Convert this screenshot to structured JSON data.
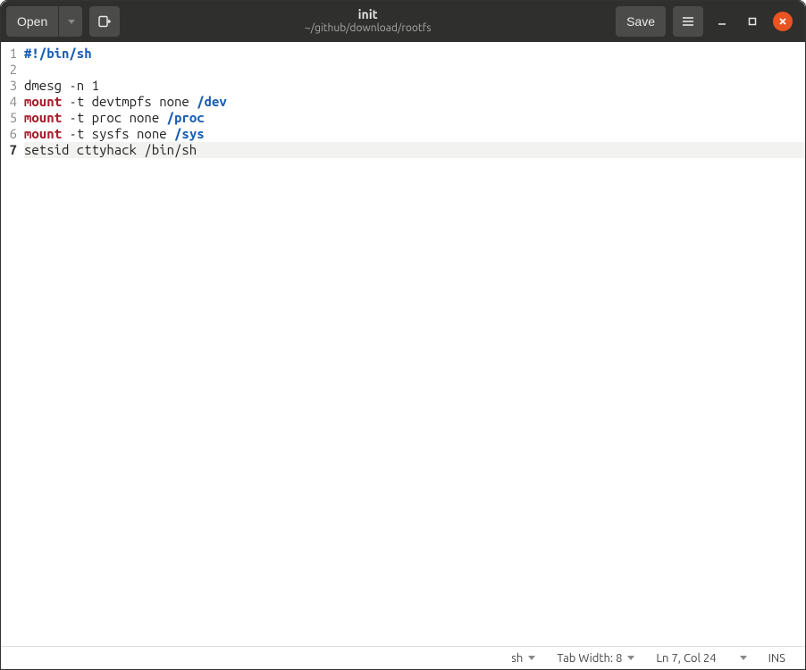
{
  "titlebar": {
    "open_label": "Open",
    "save_label": "Save",
    "title": "init",
    "subtitle": "~/github/download/rootfs"
  },
  "statusbar": {
    "language": "sh",
    "tab_width_label": "Tab Width: 8",
    "cursor_pos": "Ln 7, Col 24",
    "mode": "INS"
  },
  "editor": {
    "current_line": 7,
    "lines": [
      {
        "n": 1,
        "tokens": [
          {
            "cls": "tok-shebang",
            "text": "#!/bin/sh"
          }
        ]
      },
      {
        "n": 2,
        "tokens": [
          {
            "cls": "tok-plain",
            "text": ""
          }
        ]
      },
      {
        "n": 3,
        "tokens": [
          {
            "cls": "tok-plain",
            "text": "dmesg -n 1"
          }
        ]
      },
      {
        "n": 4,
        "tokens": [
          {
            "cls": "tok-cmd",
            "text": "mount"
          },
          {
            "cls": "tok-plain",
            "text": " -t devtmpfs none "
          },
          {
            "cls": "tok-arg",
            "text": "/dev"
          }
        ]
      },
      {
        "n": 5,
        "tokens": [
          {
            "cls": "tok-cmd",
            "text": "mount"
          },
          {
            "cls": "tok-plain",
            "text": " -t proc none "
          },
          {
            "cls": "tok-arg",
            "text": "/proc"
          }
        ]
      },
      {
        "n": 6,
        "tokens": [
          {
            "cls": "tok-cmd",
            "text": "mount"
          },
          {
            "cls": "tok-plain",
            "text": " -t sysfs none "
          },
          {
            "cls": "tok-arg",
            "text": "/sys"
          }
        ]
      },
      {
        "n": 7,
        "tokens": [
          {
            "cls": "tok-plain",
            "text": "setsid cttyhack /bin/sh"
          }
        ]
      }
    ]
  }
}
